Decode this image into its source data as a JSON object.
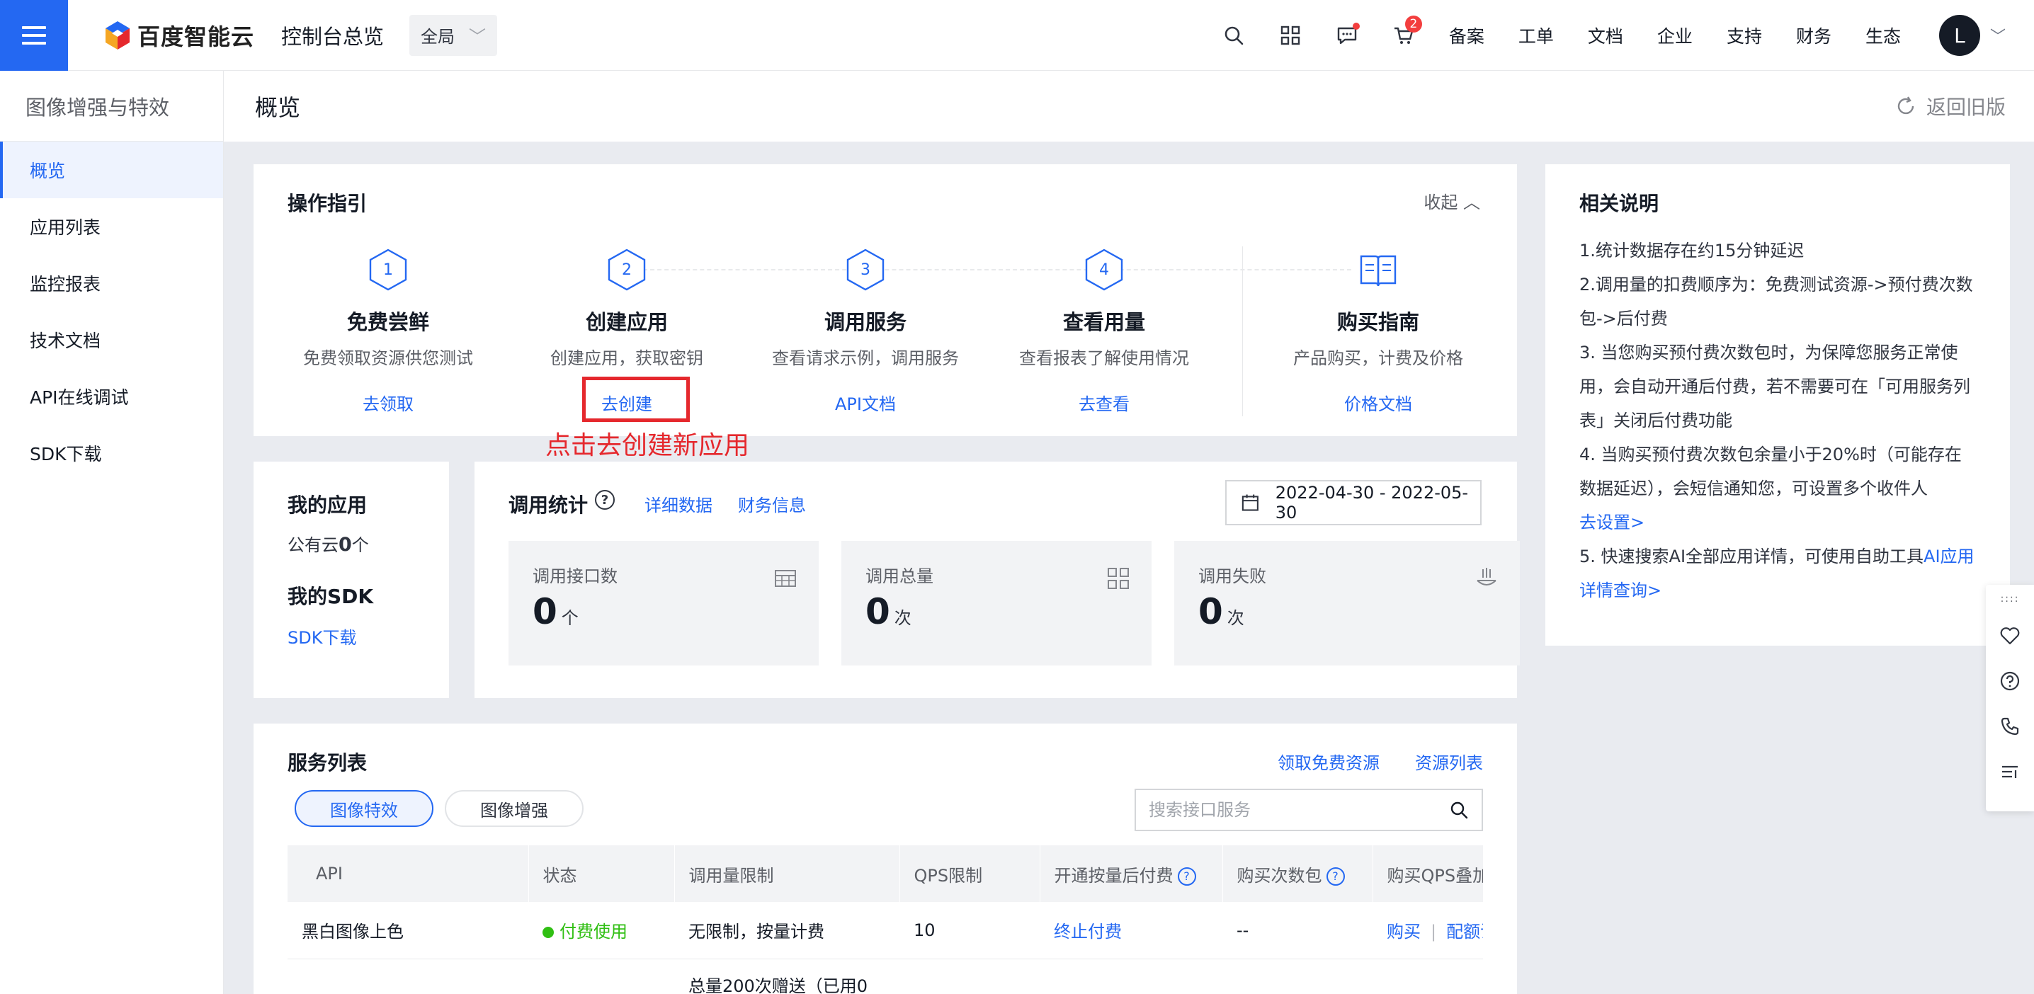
{
  "colors": {
    "primary": "#2468f2",
    "success": "#30bf13",
    "annotation": "#e5282d",
    "text": "#151b26"
  },
  "topnav": {
    "logo_text": "百度智能云",
    "console_title": "控制台总览",
    "region": "全局",
    "cart_count": "2",
    "links": [
      "备案",
      "工单",
      "文档",
      "企业",
      "支持",
      "财务",
      "生态"
    ],
    "avatar_letter": "L",
    "icons": [
      "search-icon",
      "grid-icon",
      "message-icon",
      "cart-icon"
    ]
  },
  "sidebar": {
    "title": "图像增强与特效",
    "items": [
      {
        "label": "概览",
        "active": true
      },
      {
        "label": "应用列表"
      },
      {
        "label": "监控报表"
      },
      {
        "label": "技术文档"
      },
      {
        "label": "API在线调试"
      },
      {
        "label": "SDK下载"
      }
    ]
  },
  "header": {
    "title": "概览",
    "back_label": "返回旧版"
  },
  "guide": {
    "title": "操作指引",
    "collapse_label": "收起",
    "steps": [
      {
        "num": "1",
        "name": "免费尝鲜",
        "desc": "免费领取资源供您测试",
        "link": "去领取"
      },
      {
        "num": "2",
        "name": "创建应用",
        "desc": "创建应用，获取密钥",
        "link": "去创建"
      },
      {
        "num": "3",
        "name": "调用服务",
        "desc": "查看请求示例，调用服务",
        "link": "API文档"
      },
      {
        "num": "4",
        "name": "查看用量",
        "desc": "查看报表了解使用情况",
        "link": "去查看"
      },
      {
        "num": "",
        "name": "购买指南",
        "desc": "产品购买，计费及价格",
        "link": "价格文档"
      }
    ],
    "annotation": "点击去创建新应用"
  },
  "myapps": {
    "title": "我的应用",
    "public_cloud_prefix": "公有云",
    "public_cloud_count": "0",
    "public_cloud_suffix": "个",
    "sdk_title": "我的SDK",
    "sdk_link": "SDK下载"
  },
  "stats": {
    "title": "调用统计",
    "detail_link": "详细数据",
    "finance_link": "财务信息",
    "date_range": "2022-04-30 - 2022-05-30",
    "boxes": [
      {
        "label": "调用接口数",
        "value": "0",
        "unit": "个",
        "icon": "table-icon"
      },
      {
        "label": "调用总量",
        "value": "0",
        "unit": "次",
        "icon": "grid-icon"
      },
      {
        "label": "调用失败",
        "value": "0",
        "unit": "次",
        "icon": "failure-icon"
      }
    ]
  },
  "notes": {
    "title": "相关说明",
    "items": [
      {
        "text": "1.统计数据存在约15分钟延迟"
      },
      {
        "text": "2.调用量的扣费顺序为：免费测试资源->预付费次数包->后付费"
      },
      {
        "text": "3. 当您购买预付费次数包时，为保障您服务正常使用，会自动开通后付费，若不需要可在「可用服务列表」关闭后付费功能"
      },
      {
        "text": "4. 当购买预付费次数包余量小于20%时（可能存在数据延迟），会短信通知您，可设置多个收件人",
        "link": "去设置>"
      },
      {
        "text": "5. 快速搜索AI全部应用详情，可使用自助工具",
        "link": "AI应用详情查询>"
      }
    ]
  },
  "services": {
    "title": "服务列表",
    "free_link": "领取免费资源",
    "resource_link": "资源列表",
    "tabs": [
      {
        "label": "图像特效",
        "active": true
      },
      {
        "label": "图像增强"
      }
    ],
    "search_placeholder": "搜索接口服务",
    "columns": [
      "API",
      "状态",
      "调用量限制",
      "QPS限制",
      "开通按量后付费",
      "购买次数包",
      "购买QPS叠加包"
    ],
    "rows": [
      {
        "api": "黑白图像上色",
        "status": "付费使用",
        "limit": "无限制，按量计费",
        "qps": "10",
        "postpay": "终止付费",
        "pack": "--",
        "buy": "购买",
        "config": "配额调整"
      },
      {
        "api": "",
        "status": "",
        "limit": "总量200次赠送（已用0",
        "qps": "",
        "postpay": "",
        "pack": "",
        "buy": "",
        "config": ""
      }
    ]
  }
}
